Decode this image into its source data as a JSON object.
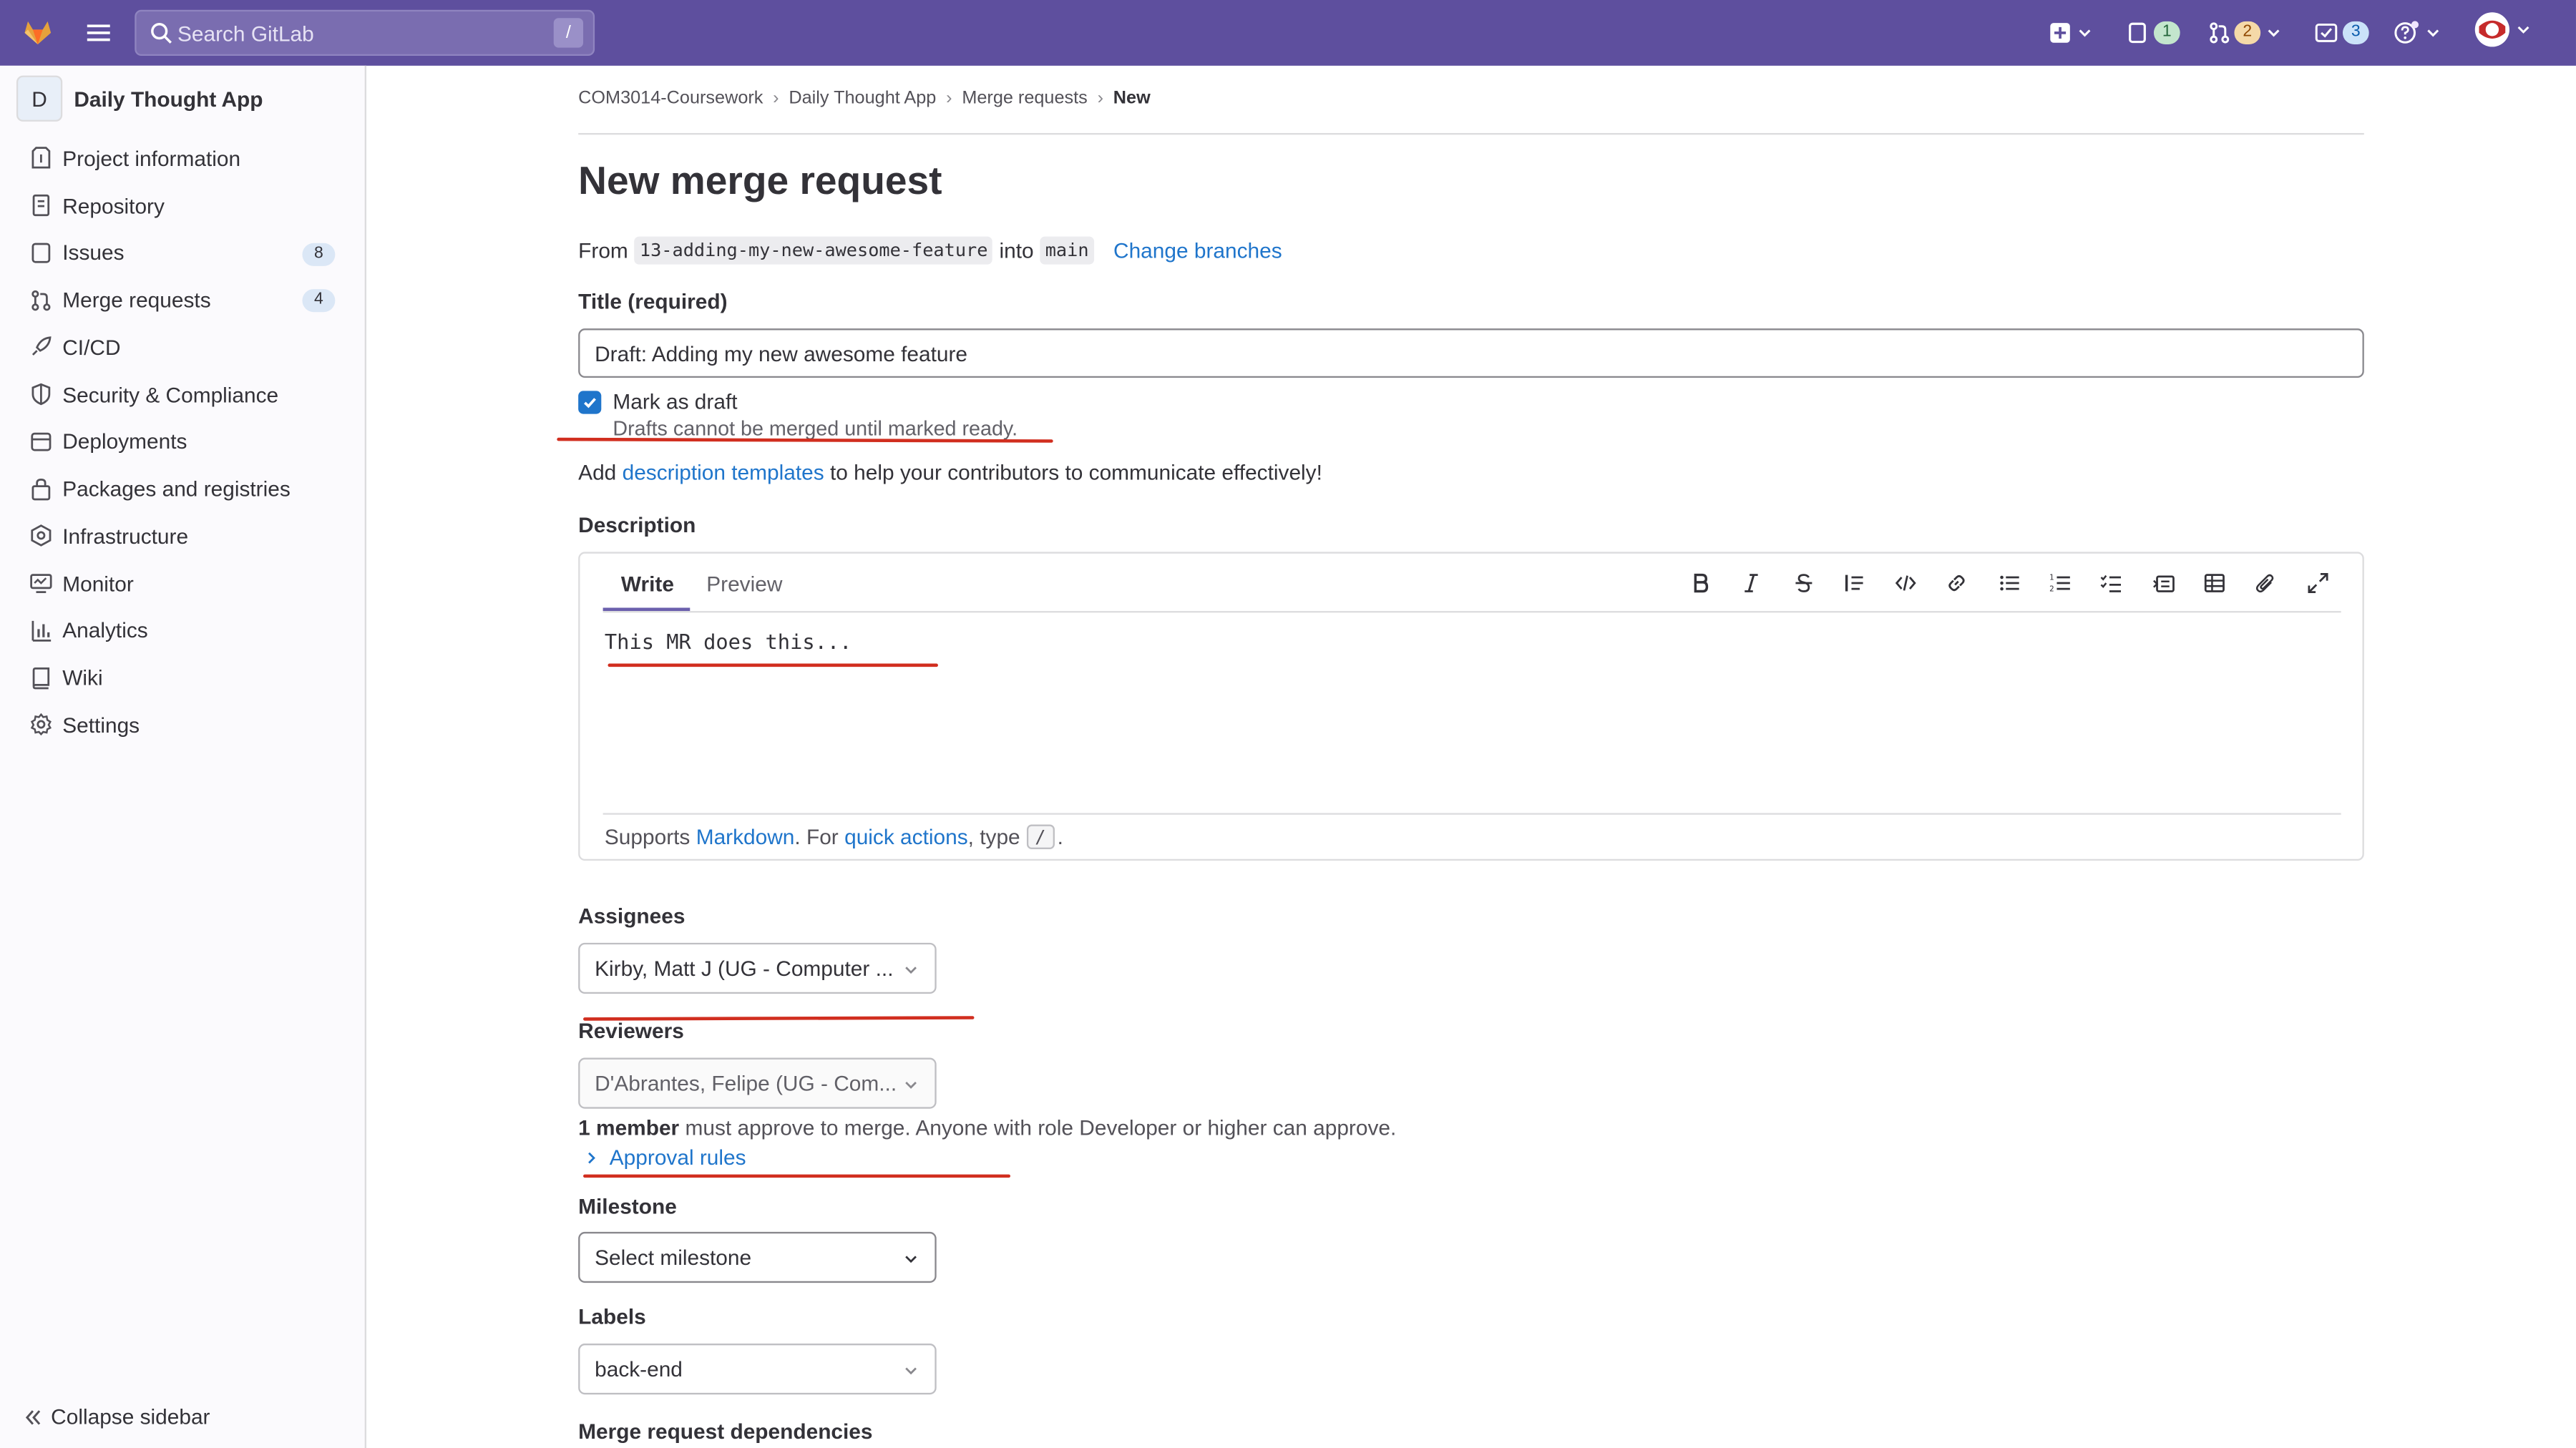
{
  "topbar": {
    "search_placeholder": "Search GitLab",
    "search_shortcut": "/",
    "issues_count": "1",
    "merge_requests_count": "2",
    "todos_count": "3"
  },
  "sidebar": {
    "project_initial": "D",
    "project_name": "Daily Thought App",
    "items": [
      {
        "label": "Project information",
        "icon": "project-information-icon"
      },
      {
        "label": "Repository",
        "icon": "repository-icon"
      },
      {
        "label": "Issues",
        "icon": "issues-icon",
        "count": "8"
      },
      {
        "label": "Merge requests",
        "icon": "merge-request-icon",
        "count": "4"
      },
      {
        "label": "CI/CD",
        "icon": "rocket-icon"
      },
      {
        "label": "Security & Compliance",
        "icon": "shield-icon"
      },
      {
        "label": "Deployments",
        "icon": "deployments-icon"
      },
      {
        "label": "Packages and registries",
        "icon": "package-icon"
      },
      {
        "label": "Infrastructure",
        "icon": "infrastructure-icon"
      },
      {
        "label": "Monitor",
        "icon": "monitor-icon"
      },
      {
        "label": "Analytics",
        "icon": "analytics-icon"
      },
      {
        "label": "Wiki",
        "icon": "book-icon"
      },
      {
        "label": "Settings",
        "icon": "gear-icon"
      }
    ],
    "collapse_label": "Collapse sidebar"
  },
  "breadcrumbs": [
    "COM3014-Coursework",
    "Daily Thought App",
    "Merge requests",
    "New"
  ],
  "page_title": "New merge request",
  "branches": {
    "from_label": "From",
    "source": "13-adding-my-new-awesome-feature",
    "into_label": "into",
    "target": "main",
    "change_label": "Change branches"
  },
  "title_field": {
    "label": "Title (required)",
    "value": "Draft: Adding my new awesome feature"
  },
  "draft": {
    "label": "Mark as draft",
    "checked": true,
    "help": "Drafts cannot be merged until marked ready."
  },
  "templates_hint": {
    "prefix": "Add",
    "link": "description templates",
    "suffix": "to help your contributors to communicate effectively!"
  },
  "description": {
    "label": "Description",
    "tab_write": "Write",
    "tab_preview": "Preview",
    "value": "This MR does this...",
    "supports_prefix": "Supports",
    "markdown_link": "Markdown",
    "for_text": ". For",
    "quick_actions_link": "quick actions",
    "type_text": ", type",
    "slash_key": "/",
    "end_text": "."
  },
  "assignees": {
    "label": "Assignees",
    "value": "Kirby, Matt J (UG - Computer ..."
  },
  "reviewers": {
    "label": "Reviewers",
    "value": "D'Abrantes, Felipe (UG - Com..."
  },
  "approval": {
    "bold": "1 member",
    "text": "must approve to merge. Anyone with role Developer or higher can approve.",
    "rules_link": "Approval rules"
  },
  "milestone": {
    "label": "Milestone",
    "value": "Select milestone"
  },
  "labels": {
    "label": "Labels",
    "value": "back-end"
  },
  "dependencies_label": "Merge request dependencies",
  "colors": {
    "topbar": "#5e4f9e",
    "link": "#1f75cb",
    "annotation": "#d12e1f"
  }
}
